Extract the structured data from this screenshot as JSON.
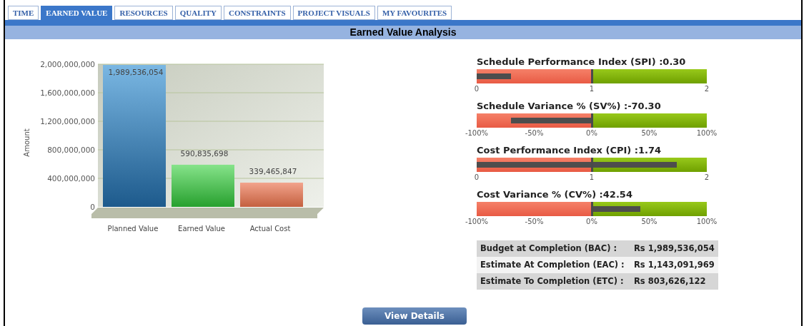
{
  "tabs": [
    {
      "label": "TIME",
      "selected": false
    },
    {
      "label": "EARNED VALUE",
      "selected": true
    },
    {
      "label": "RESOURCES",
      "selected": false
    },
    {
      "label": "QUALITY",
      "selected": false
    },
    {
      "label": "CONSTRAINTS",
      "selected": false
    },
    {
      "label": "PROJECT VISUALS",
      "selected": false
    },
    {
      "label": "MY FAVOURITES",
      "selected": false
    }
  ],
  "title": "Earned Value Analysis",
  "chart": {
    "chart_data": {
      "type": "bar",
      "ylabel": "Amount",
      "categories": [
        "Planned Value",
        "Earned Value",
        "Actual Cost"
      ],
      "series": [
        {
          "values": [
            1989536054,
            590835698,
            339465847
          ]
        }
      ],
      "grid": true,
      "ylim": [
        0,
        2000000000
      ],
      "yticks": [
        {
          "value": 0,
          "label": "0"
        },
        {
          "value": 400000000,
          "label": "400,000,000"
        },
        {
          "value": 800000000,
          "label": "800,000,000"
        },
        {
          "value": 1200000000,
          "label": "1,200,000,000"
        },
        {
          "value": 1600000000,
          "label": "1,600,000,000"
        },
        {
          "value": 2000000000,
          "label": "2,000,000,000"
        }
      ],
      "value_labels": [
        "1,989,536,054",
        "590,835,698",
        "339,465,847"
      ]
    }
  },
  "gauges": [
    {
      "kind": "index",
      "title": "Schedule Performance Index (SPI) :0.30",
      "level": 0.15,
      "ticks": [
        "0",
        "1",
        "2"
      ]
    },
    {
      "kind": "shortfall",
      "title": "Schedule Variance % (SV%) :-70.30",
      "level": 0.703,
      "ticks": [
        "-100%",
        "-50%",
        "0%",
        "50%",
        "100%"
      ]
    },
    {
      "kind": "index",
      "title": "Cost Performance Index (CPI) :1.74",
      "level": 0.87,
      "ticks": [
        "0",
        "1",
        "2"
      ]
    },
    {
      "kind": "surplus",
      "title": "Cost Variance % (CV%) :42.54",
      "level": 0.4254,
      "ticks": [
        "-100%",
        "-50%",
        "0%",
        "50%",
        "100%"
      ]
    }
  ],
  "summary": [
    {
      "label": "Budget at Completion (BAC) :",
      "value": "Rs 1,989,536,054"
    },
    {
      "label": "Estimate At Completion (EAC) :",
      "value": "Rs 1,143,091,969"
    },
    {
      "label": "Estimate To Completion (ETC) :",
      "value": "Rs 803,626,122"
    }
  ],
  "button": "View Details"
}
